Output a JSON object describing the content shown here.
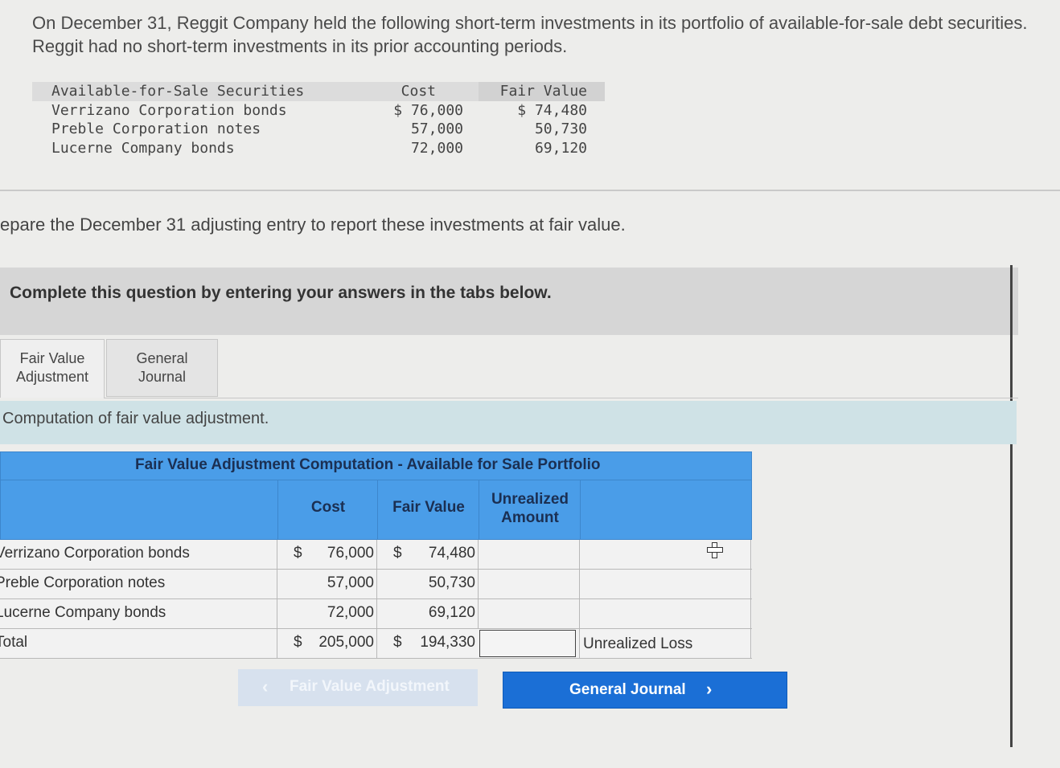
{
  "intro": "On December 31, Reggit Company held the following short-term investments in its portfolio of available-for-sale debt securities. Reggit had no short-term investments in its prior accounting periods.",
  "investments": {
    "headers": {
      "name": "Available-for-Sale Securities",
      "cost": "Cost",
      "fair_value": "Fair Value"
    },
    "rows": [
      {
        "name": "Verrizano Corporation bonds",
        "cost": "$ 76,000",
        "fair_value": "$ 74,480"
      },
      {
        "name": "Preble Corporation notes",
        "cost": "57,000",
        "fair_value": "50,730"
      },
      {
        "name": "Lucerne Company bonds",
        "cost": "72,000",
        "fair_value": "69,120"
      }
    ]
  },
  "instruction": "epare the December 31 adjusting entry to report these investments at fair value.",
  "banner": "Complete this question by entering your answers in the tabs below.",
  "tabs": [
    {
      "label": "Fair Value\nAdjustment",
      "active": true
    },
    {
      "label": "General\nJournal",
      "active": false
    }
  ],
  "subhead": "Computation of fair value adjustment.",
  "computation": {
    "title": "Fair Value Adjustment Computation - Available for Sale Portfolio",
    "headers": {
      "cost": "Cost",
      "fair_value": "Fair Value",
      "unrealized": "Unrealized\nAmount"
    },
    "rows": [
      {
        "label": "Verrizano Corporation bonds",
        "cost_sign": "$",
        "cost": "76,000",
        "fv_sign": "$",
        "fair_value": "74,480"
      },
      {
        "label": "Preble Corporation notes",
        "cost_sign": "",
        "cost": "57,000",
        "fv_sign": "",
        "fair_value": "50,730"
      },
      {
        "label": "Lucerne Company bonds",
        "cost_sign": "",
        "cost": "72,000",
        "fv_sign": "",
        "fair_value": "69,120"
      }
    ],
    "total": {
      "label": "Total",
      "cost_sign": "$",
      "cost": "205,000",
      "fv_sign": "$",
      "fair_value": "194,330",
      "unrealized_value": "",
      "result_label": "Unrealized Loss"
    }
  },
  "buttons": {
    "prev": "Fair Value Adjustment",
    "next": "General Journal"
  }
}
